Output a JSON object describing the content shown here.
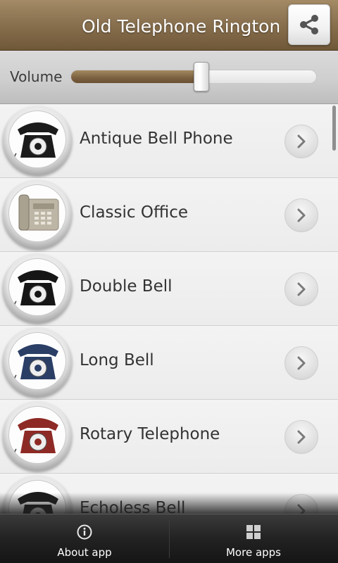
{
  "header": {
    "title": "Old Telephone Rington",
    "share_icon": "share-icon"
  },
  "volume": {
    "label": "Volume",
    "level": 0.53
  },
  "ringtones": [
    {
      "label": "Antique Bell Phone",
      "phone_color": "#1b1b1b",
      "icon": "rotary-phone-icon"
    },
    {
      "label": "Classic Office",
      "phone_color": "#bdb6a6",
      "icon": "office-phone-icon"
    },
    {
      "label": "Double Bell",
      "phone_color": "#161616",
      "icon": "rotary-phone-icon"
    },
    {
      "label": "Long Bell",
      "phone_color": "#2a3e66",
      "icon": "rotary-phone-icon"
    },
    {
      "label": "Rotary Telephone",
      "phone_color": "#8e2a25",
      "icon": "rotary-phone-icon"
    },
    {
      "label": "Echoless Bell",
      "phone_color": "#1c1c1c",
      "icon": "rotary-phone-icon"
    }
  ],
  "bottom_nav": {
    "about_label": "About app",
    "about_icon": "info-icon",
    "more_label": "More apps",
    "more_icon": "grid-icon"
  },
  "colors": {
    "header_brown": "#8a7150",
    "bottom_bar": "#222222"
  }
}
